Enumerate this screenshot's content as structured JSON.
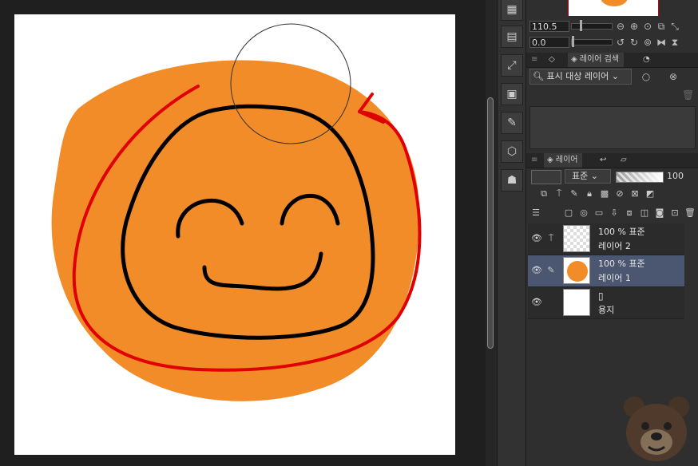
{
  "canvas": {
    "colors": {
      "paper": "#ffffff",
      "fill": "#f28c28",
      "stroke_black": "#000000",
      "stroke_red": "#e00000"
    }
  },
  "navigator": {
    "zoom_value": "110.5",
    "rotation_value": "0.0"
  },
  "layer_search_panel": {
    "tab_label": "레이어 검색",
    "filter_select": "표시 대상 레이어"
  },
  "layer_panel": {
    "tab_label": "레이어",
    "blend_mode": "표준",
    "opacity_value": "100",
    "opacity_fraction": 1.0,
    "layers": [
      {
        "mode_label": "100 % 표준",
        "name": "레이어 2",
        "selected": false,
        "thumb": "checker"
      },
      {
        "mode_label": "100 % 표준",
        "name": "레이어 1",
        "selected": true,
        "thumb": "orange"
      },
      {
        "mode_label": "",
        "name": "용지",
        "selected": false,
        "thumb": "white"
      }
    ]
  }
}
